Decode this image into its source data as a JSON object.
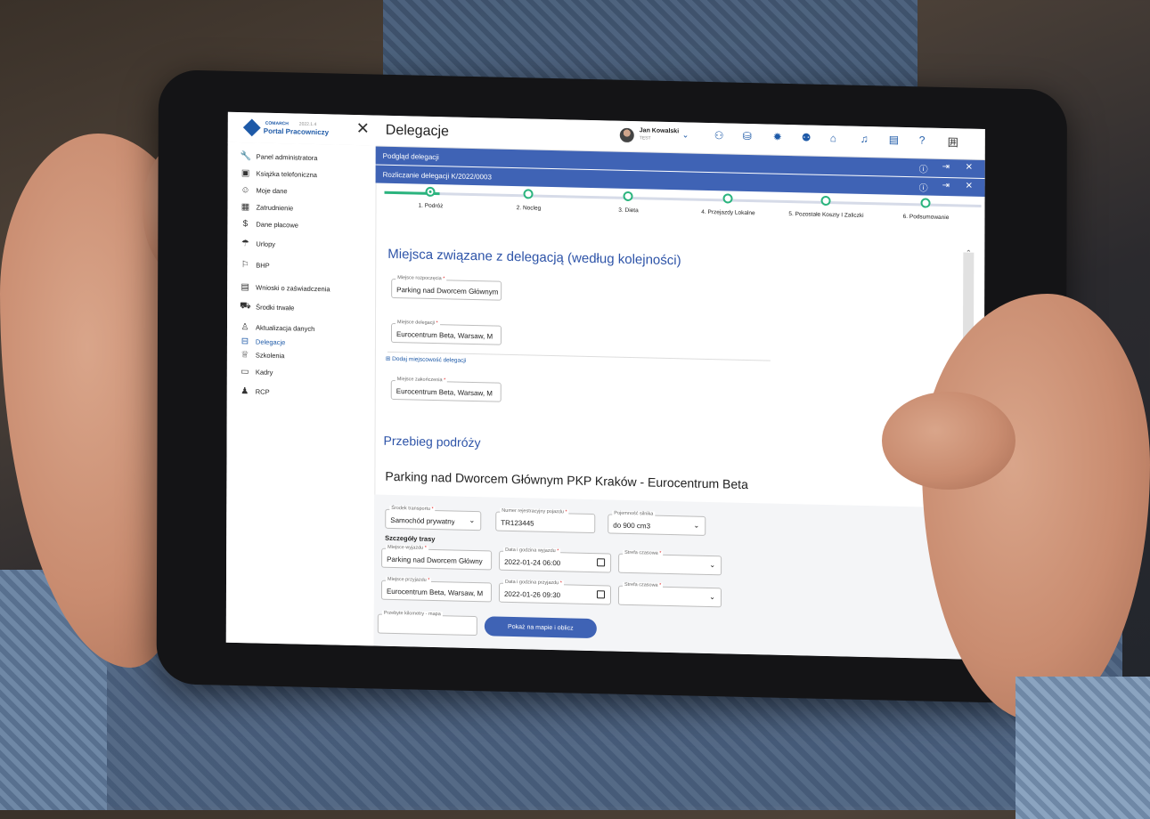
{
  "header": {
    "logo_brand": "COMARCH",
    "logo_version": "2022.1.4",
    "logo_product": "Portal Pracowniczy",
    "page_title": "Delegacje",
    "user_name": "Jan Kowalski",
    "user_sub": "TEST",
    "toolbar_icons": [
      "users-question-icon",
      "database-icon",
      "gear-icon",
      "team-icon",
      "home-icon",
      "notification-bell-icon",
      "messages-icon",
      "help-icon",
      "language-icon"
    ]
  },
  "sidebar": {
    "items": [
      {
        "label": "Panel administratora",
        "icon": "wrench-icon"
      },
      {
        "label": "Książka telefoniczna",
        "icon": "contacts-icon"
      },
      {
        "label": "Moje dane",
        "icon": "profile-icon"
      },
      {
        "label": "Zatrudnienie",
        "icon": "employment-icon"
      },
      {
        "label": "Dane płacowe",
        "icon": "dollar-icon"
      },
      {
        "label": "Urlopy",
        "icon": "beach-icon"
      },
      {
        "label": "BHP",
        "icon": "running-icon"
      },
      {
        "label": "Wnioski o zaświadczenia",
        "icon": "document-icon"
      },
      {
        "label": "Środki trwałe",
        "icon": "car-icon"
      },
      {
        "label": "Aktualizacja danych",
        "icon": "user-edit-icon"
      },
      {
        "label": "Delegacje",
        "icon": "briefcase-icon",
        "active": true
      },
      {
        "label": "Szkolenia",
        "icon": "graduation-icon"
      },
      {
        "label": "Kadry",
        "icon": "id-card-icon"
      },
      {
        "label": "RCP",
        "icon": "time-user-icon"
      }
    ]
  },
  "bars": {
    "preview": "Podgląd delegacji",
    "settlement": "Rozliczanie delegacji K/2022/0003"
  },
  "stepper": {
    "steps": [
      "1. Podróż",
      "2. Nocleg",
      "3. Dieta",
      "4. Przejazdy Lokalne",
      "5. Pozostałe Koszty I Zaliczki",
      "6. Podsumowanie"
    ],
    "active_step": 1
  },
  "places": {
    "title": "Miejsca związane z delegacją (według kolejności)",
    "start_label": "Miejsce rozpoczęcia",
    "start_value": "Parking nad Dworcem Głównym",
    "delegation_label": "Miejsce delegacji",
    "delegation_value": "Eurocentrum Beta, Warsaw, M",
    "add_link": "⊞ Dodaj miejscowość delegacji",
    "end_label": "Miejsce zakończenia",
    "end_value": "Eurocentrum Beta, Warsaw, M"
  },
  "trip": {
    "title": "Przebieg podróży",
    "route": "Parking nad Dworcem Głównym PKP Kraków - Eurocentrum Beta",
    "transport_label": "Środek transportu",
    "transport_value": "Samochód prywatny",
    "plate_label": "Numer rejestracyjny pojazdu",
    "plate_value": "TR123445",
    "engine_label": "Pojemność silnika",
    "engine_value": "do 900 cm3",
    "route_details": "Szczegóły trasy",
    "dep_place_label": "Miejsce wyjazdu",
    "dep_place_value": "Parking nad Dworcem Główny",
    "dep_date_label": "Data i godzina wyjazdu",
    "dep_date_value": "2022-01-24 06:00",
    "tz_label": "Strefa czasowa",
    "arr_place_label": "Miejsce przyjazdu",
    "arr_place_value": "Eurocentrum Beta, Warsaw, M",
    "arr_date_label": "Data i godzina przyjazdu",
    "arr_date_value": "2022-01-26 09:30",
    "tz2_label": "Strefa czasowa",
    "km_label": "Przebyte kilometry - mapa",
    "km_value": "",
    "map_button": "Pokaż na mapie i oblicz"
  },
  "colors": {
    "accent": "#3f63b5",
    "step_done": "#2bb47e",
    "required": "#e02424"
  }
}
